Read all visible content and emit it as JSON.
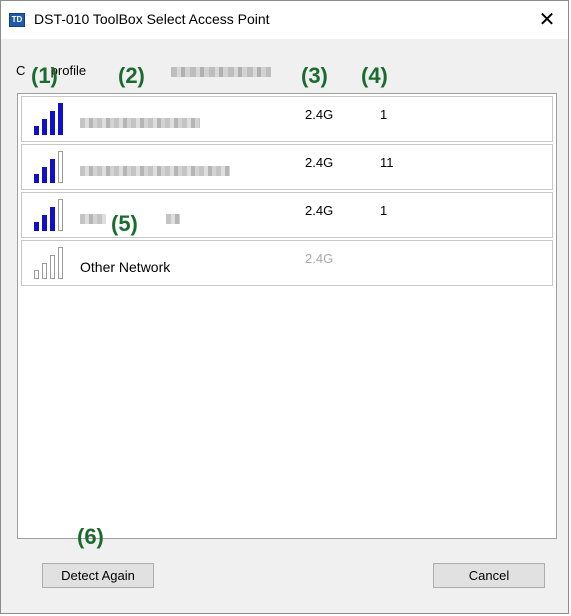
{
  "window": {
    "title": "DST-010 ToolBox Select Access Point",
    "app_icon_text": "TD",
    "close_glyph": "✕"
  },
  "profile": {
    "label": "C       profile"
  },
  "callouts": [
    "(1)",
    "(2)",
    "(3)",
    "(4)",
    "(5)",
    "(6)"
  ],
  "columns": {
    "band_heading": "",
    "channel_heading": ""
  },
  "networks": [
    {
      "name": "",
      "band": "2.4G",
      "channel": "1",
      "signal_bars": 4,
      "name_blurred": true
    },
    {
      "name": "",
      "band": "2.4G",
      "channel": "11",
      "signal_bars": 3,
      "name_blurred": true
    },
    {
      "name": "",
      "band": "2.4G",
      "channel": "1",
      "signal_bars": 3,
      "name_blurred": true
    },
    {
      "name": "Other Network",
      "band": "2.4G",
      "channel": "",
      "signal_bars": 0,
      "name_blurred": false
    }
  ],
  "buttons": {
    "detect_again": "Detect Again",
    "cancel": "Cancel"
  },
  "colors": {
    "signal_on": "#1010c8",
    "signal_off_border": "#9a9a9a",
    "callout": "#1b6b2e",
    "disabled_text": "#a8a8a8"
  },
  "icons": {
    "signal": "wifi-signal-bars-icon",
    "close": "close-icon",
    "app": "app-icon"
  }
}
